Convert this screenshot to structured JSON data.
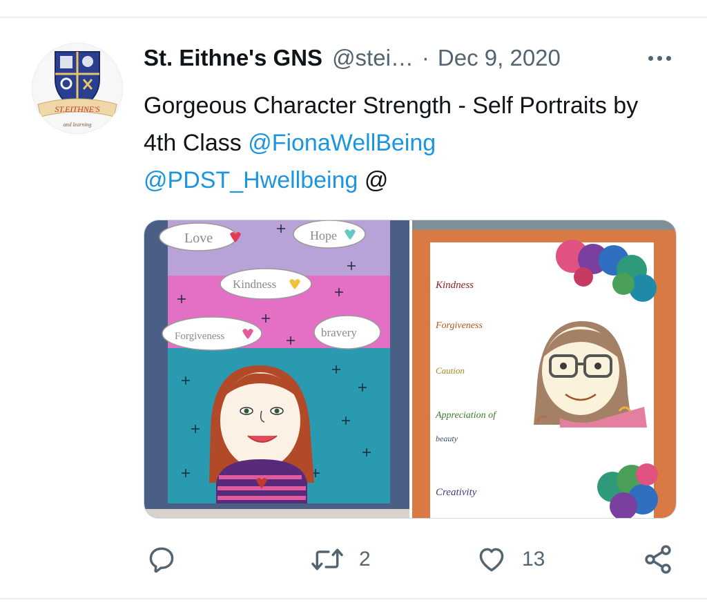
{
  "tweet": {
    "author_name": "St. Eithne's GNS",
    "handle": "@stei…",
    "separator": "·",
    "date": "Dec 9, 2020",
    "text_plain": "Gorgeous Character Strength - Self Portraits by 4th Class",
    "mention_1": "@FionaWellBeing",
    "mention_2": "@PDST_Hwellbeing",
    "trailing": "@",
    "avatar": {
      "crest_banner": "ST.EITHNE'S",
      "crest_motto": "and learning",
      "colors": {
        "shield": "#2a3f8f",
        "banner": "#f0d7a8",
        "banner_text": "#c0392b"
      }
    }
  },
  "media": {
    "left_photo": {
      "words": [
        "Love",
        "Hope",
        "Kindness",
        "Forgiveness",
        "bravery"
      ]
    },
    "right_photo": {
      "words": [
        "Kindness",
        "Forgiveness",
        "Caution",
        "Appreciation of",
        "beauty",
        "Creativity"
      ]
    }
  },
  "actions": {
    "reply_icon": "reply-icon",
    "retweet_icon": "retweet-icon",
    "retweet_count": "2",
    "like_icon": "heart-icon",
    "like_count": "13",
    "share_icon": "share-icon"
  },
  "colors": {
    "mention": "#1b95e0",
    "secondary_text": "#536471"
  }
}
